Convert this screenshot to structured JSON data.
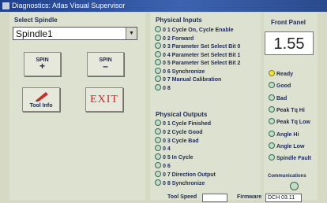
{
  "window": {
    "title": "Diagnostics: Atlas Visual Supervisor"
  },
  "spindle": {
    "label": "Select Spindle",
    "selected": "Spindle1",
    "spin_plus": {
      "label": "SPIN",
      "sign": "+"
    },
    "spin_minus": {
      "label": "SPIN",
      "sign": "–"
    },
    "tool_info": "Tool Info",
    "exit": "EXIT"
  },
  "physical_inputs": {
    "title": "Physical Inputs",
    "items": [
      "0 1  Cycle On, Cycle Enable",
      "0 2  Forward",
      "0 3  Parameter Set Select Bit 0",
      "0 4  Parameter Set Select Bit 1",
      "0 5  Parameter Set Select Bit 2",
      "0 6  Synchronize",
      "0 7  Manual Calibration",
      "0 8"
    ]
  },
  "physical_outputs": {
    "title": "Physical Outputs",
    "items": [
      "0 1  Cycle Finished",
      "0 2  Cycle Good",
      "0 3  Cycle Bad",
      "0 4",
      "0 5  In Cycle",
      "0 6",
      "0 7  Direction Output",
      "0 8  Synchronize"
    ]
  },
  "front_panel": {
    "title": "Front Panel",
    "value": "1.55",
    "indicators": [
      "Ready",
      "Good",
      "Bad",
      "Peak Tq Hi",
      "Peak Tq Low",
      "Angle Hi",
      "Angle Low",
      "Spindle Fault"
    ],
    "communications": "Communications"
  },
  "bottom": {
    "tool_speed_label": "Tool Speed",
    "firmware_label": "Firmware",
    "firmware_value": "DCH 03.11"
  },
  "colors": {
    "titlebar": "#2a4a8c",
    "ready_led": "#f0e53a",
    "led_off": "#c6dac7"
  }
}
